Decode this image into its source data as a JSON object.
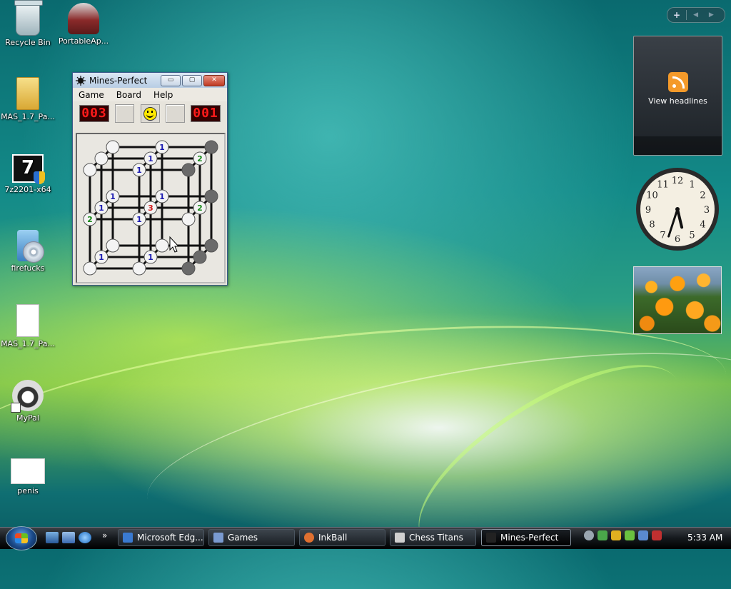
{
  "desktop": {
    "icons": [
      {
        "label": "Recycle Bin",
        "icon": "recycle-bin-icon"
      },
      {
        "label": "PortableAp...",
        "icon": "portableapps-icon"
      },
      {
        "label": "MAS_1.7_Pa...",
        "icon": "folder-icon"
      },
      {
        "label": "7z2201-x64",
        "icon": "7zip-installer-icon"
      },
      {
        "label": "firefucks",
        "icon": "setup-cd-icon"
      },
      {
        "label": "MAS_1.7_Pa...",
        "icon": "document-icon"
      },
      {
        "label": "MyPal",
        "icon": "mypal-raccoon-icon"
      },
      {
        "label": "penis",
        "icon": "text-file-icon"
      }
    ]
  },
  "window": {
    "title": "Mines-Perfect",
    "buttons": {
      "minimize": "▭",
      "maximize": "▢",
      "close": "✕"
    },
    "menu": [
      "Game",
      "Board",
      "Help"
    ],
    "mines_counter": "003",
    "timer": "001",
    "board": {
      "cells": [
        {
          "n": "1",
          "c": "#1a1ab0"
        },
        {
          "n": "1",
          "c": "#1a1ab0"
        },
        {
          "n": "1",
          "c": "#1a1ab0"
        },
        {
          "n": "1",
          "c": "#1a1ab0"
        },
        {
          "n": "2",
          "c": "#1a8a1a"
        },
        {
          "n": "1",
          "c": "#1a1ab0"
        },
        {
          "n": "3",
          "c": "#d01a1a"
        },
        {
          "n": "2",
          "c": "#1a8a1a"
        },
        {
          "n": "1",
          "c": "#1a1ab0"
        },
        {
          "n": "1",
          "c": "#1a1ab0"
        },
        {
          "n": "1",
          "c": "#1a1ab0"
        },
        {
          "n": "2",
          "c": "#1a8a1a"
        },
        {
          "n": "1",
          "c": "#1a1ab0"
        }
      ]
    }
  },
  "sidebar": {
    "controls": {
      "add": "+",
      "nav": "◀ ▶"
    },
    "feed": {
      "label": "View headlines"
    },
    "clock": {
      "numerals": [
        "12",
        "1",
        "2",
        "3",
        "4",
        "5",
        "6",
        "7",
        "8",
        "9",
        "10",
        "11"
      ],
      "hour": 5,
      "minute": 33
    }
  },
  "taskbar": {
    "tasks": [
      {
        "label": "Microsoft Edg...",
        "color": "#3a7ad0"
      },
      {
        "label": "Games",
        "color": "#7a9ad0"
      },
      {
        "label": "InkBall",
        "color": "#e07030"
      },
      {
        "label": "Chess Titans",
        "color": "#d0d0d0"
      },
      {
        "label": "Mines-Perfect",
        "color": "#222",
        "active": true
      }
    ],
    "time": "5:33 AM"
  }
}
